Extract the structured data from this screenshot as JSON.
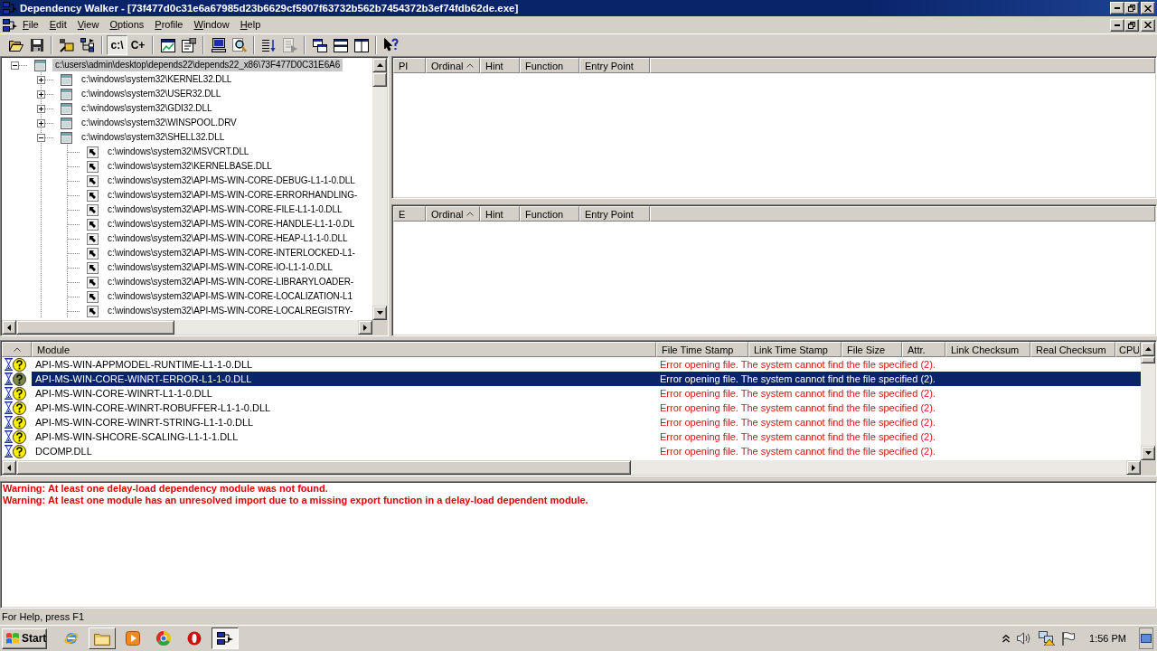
{
  "window": {
    "title": "Dependency Walker - [73f477d0c31e6a67985d23b6629cf5907f63732b562b7454372b3ef74fdb62de.exe]"
  },
  "menu": [
    "File",
    "Edit",
    "View",
    "Options",
    "Profile",
    "Window",
    "Help"
  ],
  "toolbar": [
    [
      {
        "pressed": false,
        "disabled": false
      },
      {
        "pressed": false,
        "disabled": false
      }
    ],
    [
      {
        "pressed": false,
        "disabled": false
      },
      {
        "pressed": false,
        "disabled": false
      }
    ],
    [
      {
        "label": "c:\\",
        "pressed": true,
        "disabled": false
      },
      {
        "label": "C+",
        "pressed": false,
        "disabled": false
      }
    ],
    [
      {
        "pressed": false,
        "disabled": false
      },
      {
        "pressed": false,
        "disabled": false
      }
    ],
    [
      {
        "pressed": false,
        "disabled": false
      },
      {
        "pressed": false,
        "disabled": false
      }
    ],
    [
      {
        "pressed": false,
        "disabled": false
      },
      {
        "pressed": false,
        "disabled": true
      }
    ],
    [
      {
        "pressed": false,
        "disabled": false
      },
      {
        "pressed": false,
        "disabled": false
      },
      {
        "pressed": false,
        "disabled": false
      }
    ],
    [
      {
        "pressed": false,
        "disabled": false
      }
    ]
  ],
  "module_tree": [
    {
      "label": "c:\\users\\admin\\desktop\\depends22\\depends22_x86\\73F477D0C31E6A6",
      "selected": true,
      "expanded": true,
      "children": [
        {
          "label": "c:\\windows\\system32\\KERNEL32.DLL",
          "selected": false,
          "expanded": false
        },
        {
          "label": "c:\\windows\\system32\\USER32.DLL",
          "selected": false,
          "expanded": false
        },
        {
          "label": "c:\\windows\\system32\\GDI32.DLL",
          "selected": false,
          "expanded": false
        },
        {
          "label": "c:\\windows\\system32\\WINSPOOL.DRV",
          "selected": false,
          "expanded": false
        },
        {
          "label": "c:\\windows\\system32\\SHELL32.DLL",
          "selected": false,
          "expanded": true,
          "children": [
            {
              "label": "c:\\windows\\system32\\MSVCRT.DLL",
              "selected": false
            },
            {
              "label": "c:\\windows\\system32\\KERNELBASE.DLL",
              "selected": false
            },
            {
              "label": "c:\\windows\\system32\\API-MS-WIN-CORE-DEBUG-L1-1-0.DLL",
              "selected": false
            },
            {
              "label": "c:\\windows\\system32\\API-MS-WIN-CORE-ERRORHANDLING-",
              "selected": false
            },
            {
              "label": "c:\\windows\\system32\\API-MS-WIN-CORE-FILE-L1-1-0.DLL",
              "selected": false
            },
            {
              "label": "c:\\windows\\system32\\API-MS-WIN-CORE-HANDLE-L1-1-0.DL",
              "selected": false
            },
            {
              "label": "c:\\windows\\system32\\API-MS-WIN-CORE-HEAP-L1-1-0.DLL",
              "selected": false
            },
            {
              "label": "c:\\windows\\system32\\API-MS-WIN-CORE-INTERLOCKED-L1-",
              "selected": false
            },
            {
              "label": "c:\\windows\\system32\\API-MS-WIN-CORE-IO-L1-1-0.DLL",
              "selected": false
            },
            {
              "label": "c:\\windows\\system32\\API-MS-WIN-CORE-LIBRARYLOADER-",
              "selected": false
            },
            {
              "label": "c:\\windows\\system32\\API-MS-WIN-CORE-LOCALIZATION-L1",
              "selected": false
            },
            {
              "label": "c:\\windows\\system32\\API-MS-WIN-CORE-LOCALREGISTRY-",
              "selected": false
            }
          ]
        }
      ]
    }
  ],
  "import_pane": {
    "columns": [
      {
        "label": "PI",
        "sorted": false
      },
      {
        "label": "Ordinal",
        "sorted": true
      },
      {
        "label": "Hint",
        "sorted": false
      },
      {
        "label": "Function",
        "sorted": false
      },
      {
        "label": "Entry Point",
        "sorted": false
      }
    ]
  },
  "export_pane": {
    "columns": [
      {
        "label": "E",
        "sorted": false
      },
      {
        "label": "Ordinal",
        "sorted": true
      },
      {
        "label": "Hint",
        "sorted": false
      },
      {
        "label": "Function",
        "sorted": false
      },
      {
        "label": "Entry Point",
        "sorted": false
      }
    ]
  },
  "module_list": {
    "columns": [
      {
        "sorted": true
      },
      {
        "label": "Module",
        "sorted": false
      },
      {
        "label": "File Time Stamp",
        "sorted": false
      },
      {
        "label": "Link Time Stamp",
        "sorted": false
      },
      {
        "label": "File Size",
        "sorted": false
      },
      {
        "label": "Attr.",
        "sorted": false
      },
      {
        "label": "Link Checksum",
        "sorted": false
      },
      {
        "label": "Real Checksum",
        "sorted": false
      },
      {
        "label": "CPU",
        "sorted": false
      }
    ],
    "rows": [
      {
        "module": "API-MS-WIN-APPMODEL-RUNTIME-L1-1-0.DLL",
        "message": "Error opening file. The system cannot find the file specified (2).",
        "selected": false
      },
      {
        "module": "API-MS-WIN-CORE-WINRT-ERROR-L1-1-0.DLL",
        "message": "Error opening file. The system cannot find the file specified (2).",
        "selected": true
      },
      {
        "module": "API-MS-WIN-CORE-WINRT-L1-1-0.DLL",
        "message": "Error opening file. The system cannot find the file specified (2).",
        "selected": false
      },
      {
        "module": "API-MS-WIN-CORE-WINRT-ROBUFFER-L1-1-0.DLL",
        "message": "Error opening file. The system cannot find the file specified (2).",
        "selected": false
      },
      {
        "module": "API-MS-WIN-CORE-WINRT-STRING-L1-1-0.DLL",
        "message": "Error opening file. The system cannot find the file specified (2).",
        "selected": false
      },
      {
        "module": "API-MS-WIN-SHCORE-SCALING-L1-1-1.DLL",
        "message": "Error opening file. The system cannot find the file specified (2).",
        "selected": false
      },
      {
        "module": "DCOMP.DLL",
        "message": "Error opening file. The system cannot find the file specified (2).",
        "selected": false
      }
    ]
  },
  "log": [
    "Warning: At least one delay-load dependency module was not found.",
    "Warning: At least one module has an unresolved import due to a missing export function in a delay-load dependent module."
  ],
  "status_bar": "For Help, press F1",
  "taskbar": {
    "start": "Start",
    "apps": [
      {
        "open": false,
        "selected": false
      },
      {
        "open": true,
        "selected": false
      },
      {
        "open": false,
        "selected": false
      },
      {
        "open": false,
        "selected": false
      },
      {
        "open": false,
        "selected": false
      },
      {
        "open": true,
        "selected": true
      }
    ],
    "clock": "1:56 PM"
  }
}
